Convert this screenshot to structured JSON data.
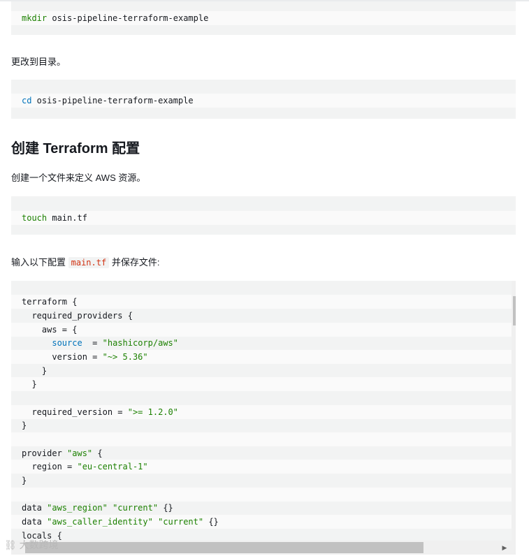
{
  "block1": {
    "cmd": "mkdir",
    "rest": " osis-pipeline-terraform-example"
  },
  "para1": "更改到目录。",
  "block2": {
    "cmd": "cd",
    "rest": " osis-pipeline-terraform-example"
  },
  "heading": "创建 Terraform 配置",
  "para2": "创建一个文件来定义 AWS 资源。",
  "block3": {
    "cmd": "touch",
    "rest": " main.tf"
  },
  "para3": {
    "before": "输入以下配置 ",
    "code": "main.tf",
    "after": " 并保存文件:"
  },
  "terraform": {
    "l1": "terraform {",
    "l2": "  required_providers {",
    "l3": "    aws = {",
    "l4_key": "source",
    "l4_mid": "  = ",
    "l4_val": "\"hashicorp/aws\"",
    "l5_key": "      version = ",
    "l5_val": "\"~> 5.36\"",
    "l6": "    }",
    "l7": "  }",
    "l9_key": "  required_version = ",
    "l9_val": "\">= 1.2.0\"",
    "l10": "}",
    "l12_key": "provider ",
    "l12_val": "\"aws\"",
    "l12_end": " {",
    "l13_key": "  region = ",
    "l13_val": "\"eu-central-1\"",
    "l14": "}",
    "l16_key": "data ",
    "l16_v1": "\"aws_region\"",
    "l16_v2": "\"current\"",
    "l16_end": " {}",
    "l17_key": "data ",
    "l17_v1": "\"aws_caller_identity\"",
    "l17_v2": "\"current\"",
    "l17_end": " {}",
    "l18": "locals {"
  },
  "watermark": "大数跨境"
}
